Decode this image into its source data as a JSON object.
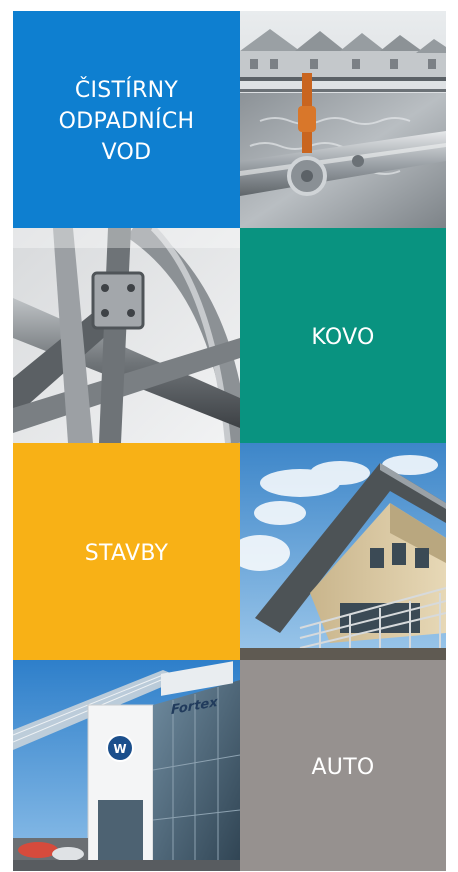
{
  "tiles": [
    {
      "id": "cistirny",
      "lines": [
        "ČISTÍRNY",
        "ODPADNÍCH",
        "VOD"
      ],
      "color": "#0e7fd0"
    },
    {
      "id": "kovo",
      "lines": [
        "KOVO"
      ],
      "color": "#099380"
    },
    {
      "id": "stavby",
      "lines": [
        "STAVBY"
      ],
      "color": "#f8b116"
    },
    {
      "id": "auto",
      "lines": [
        "AUTO"
      ],
      "color": "#96918f"
    }
  ],
  "photos": {
    "wastewater": {
      "icon": "wastewater-treatment-photo"
    },
    "metal": {
      "icon": "steel-structure-photo"
    },
    "building": {
      "icon": "building-facade-photo"
    },
    "car_dealer": {
      "icon": "car-dealership-photo",
      "sign_text": "Fortex"
    }
  }
}
